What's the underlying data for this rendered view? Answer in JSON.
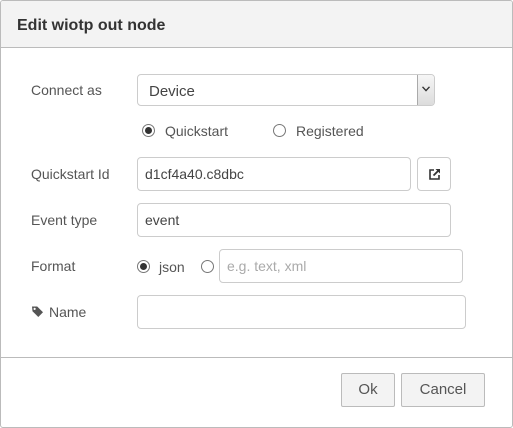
{
  "dialog": {
    "title": "Edit wiotp out node"
  },
  "form": {
    "connect_as": {
      "label": "Connect as",
      "selected": "Device"
    },
    "mode": {
      "options": [
        {
          "label": "Quickstart",
          "checked": true
        },
        {
          "label": "Registered",
          "checked": false
        }
      ]
    },
    "quickstart_id": {
      "label": "Quickstart Id",
      "value": "d1cf4a40.c8dbc"
    },
    "event_type": {
      "label": "Event type",
      "value": "event"
    },
    "format": {
      "label": "Format",
      "json_label": "json",
      "json_checked": true,
      "other_placeholder": "e.g. text, xml"
    },
    "name": {
      "label": "Name",
      "value": ""
    }
  },
  "buttons": {
    "ok": "Ok",
    "cancel": "Cancel"
  },
  "icons": {
    "dropdown": "chevron-down-icon",
    "open_external": "external-link-icon",
    "name_tag": "tag-icon"
  }
}
